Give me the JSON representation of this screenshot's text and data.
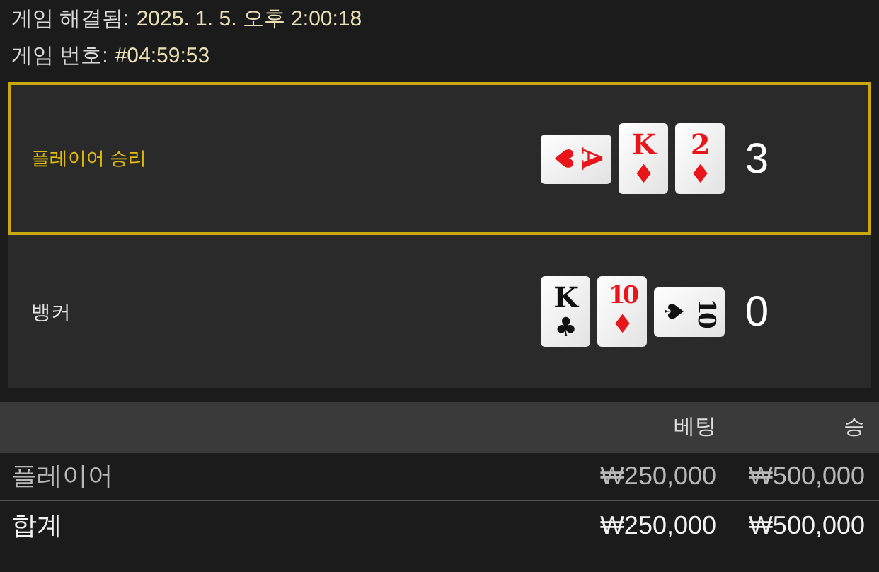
{
  "info": [
    {
      "label": "게임 해결됨:",
      "value": "2025. 1. 5. 오후 2:00:18"
    },
    {
      "label": "게임 번호:",
      "value": "#04:59:53"
    }
  ],
  "hands": [
    {
      "name": "플레이어 승리",
      "winner": true,
      "score": "3",
      "cards": [
        {
          "rank": "A",
          "suit": "♥",
          "color": "#e8161b",
          "rotated": true
        },
        {
          "rank": "K",
          "suit": "♦",
          "color": "#e8161b",
          "rotated": false
        },
        {
          "rank": "2",
          "suit": "♦",
          "color": "#e8161b",
          "rotated": false
        }
      ]
    },
    {
      "name": "뱅커",
      "winner": false,
      "score": "0",
      "cards": [
        {
          "rank": "K",
          "suit": "♣",
          "color": "#111111",
          "rotated": false
        },
        {
          "rank": "10",
          "suit": "♦",
          "color": "#e8161b",
          "rotated": false
        },
        {
          "rank": "10",
          "suit": "♠",
          "color": "#111111",
          "rotated": true
        }
      ]
    }
  ],
  "bets": {
    "columns": [
      "베팅",
      "승"
    ],
    "rows": [
      {
        "label": "플레이어",
        "kind": "row",
        "bet": "₩250,000",
        "win": "₩500,000"
      },
      {
        "label": "합계",
        "kind": "total",
        "bet": "₩250,000",
        "win": "₩500,000"
      }
    ]
  }
}
